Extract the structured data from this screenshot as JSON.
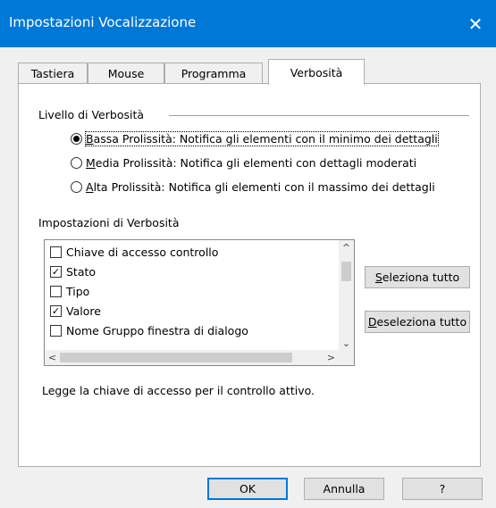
{
  "window": {
    "title": "Impostazioni Vocalizzazione",
    "close_glyph": "✕"
  },
  "tabs": [
    {
      "label": "Tastiera"
    },
    {
      "label": "Mouse"
    },
    {
      "label": "Programma"
    },
    {
      "label": "Verbosità"
    }
  ],
  "verbosity_level": {
    "label": "Livello di Verbosità",
    "options": [
      {
        "mnemonic": "B",
        "rest": "assa Prolissità: Notifica gli elementi con il minimo dei dettagli",
        "checked": true
      },
      {
        "mnemonic": "M",
        "rest": "edia Prolissità: Notifica gli elementi con dettagli moderati",
        "checked": false
      },
      {
        "mnemonic": "A",
        "rest": "lta Prolissità: Notifica gli elementi con il massimo dei dettagli",
        "checked": false
      }
    ]
  },
  "verbosity_settings": {
    "label": "Impostazioni di Verbosità",
    "items": [
      {
        "label": "Chiave di accesso controllo",
        "checked": false
      },
      {
        "label": "Stato",
        "checked": true
      },
      {
        "label": "Tipo",
        "checked": false
      },
      {
        "label": "Valore",
        "checked": true
      },
      {
        "label": "Nome Gruppo finestra di dialogo",
        "checked": false
      }
    ],
    "scroll": {
      "up": "^",
      "down": "⌄",
      "left": "<",
      "right": ">"
    }
  },
  "side_buttons": {
    "select_all": {
      "mnemonic": "S",
      "rest": "eleziona tutto"
    },
    "deselect_all": {
      "mnemonic": "D",
      "rest": "eseleziona tutto"
    }
  },
  "description": "Legge la chiave di accesso per il controllo attivo.",
  "footer": {
    "ok": "OK",
    "cancel": "Annulla",
    "help": "?"
  }
}
